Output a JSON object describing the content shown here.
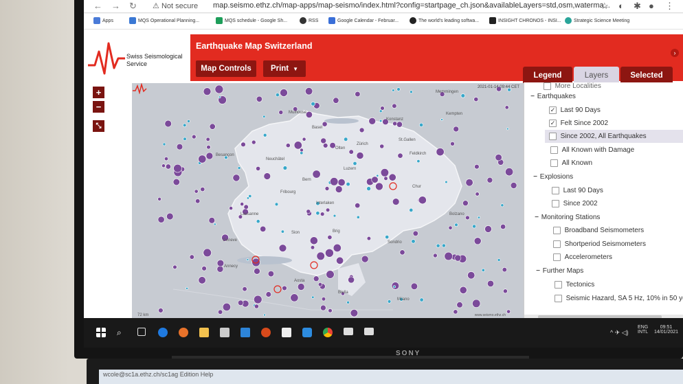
{
  "browser": {
    "not_secure": "Not secure",
    "url": "map.seismo.ethz.ch/map-apps/map-seismo/index.html?config=startpage_ch.json&availableLayers=std,osm,waterma...",
    "bookmarks": [
      {
        "label": "Apps",
        "color": "#4a7bd8"
      },
      {
        "label": "MQS Operational Planning...",
        "color": "#3b78d4"
      },
      {
        "label": "MQS schedule - Google Sh...",
        "color": "#1e9e5a"
      },
      {
        "label": "RSS",
        "color": "#333333"
      },
      {
        "label": "Google Calendar - Februar...",
        "color": "#3a6fd8"
      },
      {
        "label": "The world's leading softwa...",
        "color": "#222222"
      },
      {
        "label": "INSIGHT CHRONOS - INSI...",
        "color": "#222222"
      },
      {
        "label": "Strategic Science Meeting",
        "color": "#2aa59a"
      }
    ]
  },
  "app": {
    "logo_line1": "Swiss Seismological",
    "logo_line2": "Service",
    "title": "Earthquake Map Switzerland",
    "buttons": {
      "map_controls": "Map Controls",
      "print": "Print"
    },
    "tabs": {
      "legend": "Legend",
      "layers": "Layers",
      "selected": "Selected"
    },
    "zoom_in": "+",
    "zoom_out": "−",
    "accent": "#e22b20"
  },
  "map": {
    "timestamp": "2021-01-14 09:44 CET",
    "credit": "www.seismo.ethz.ch",
    "scale_label": "72 km",
    "places": [
      "Memmingen",
      "Kempten",
      "Mulhouse",
      "Basel",
      "Konstanz",
      "St.Gallen",
      "Zürich",
      "Olten",
      "Feldkirch",
      "Besançon",
      "Neuchâtel",
      "Luzern",
      "Bern",
      "Chur",
      "Fribourg",
      "Interlaken",
      "Lausanne",
      "Sion",
      "Brig",
      "Geneve",
      "Annecy",
      "Aosta",
      "Biella",
      "Bolzano",
      "Milano",
      "Sondrio"
    ]
  },
  "layers": {
    "partial_top": "More Localities",
    "groups": [
      {
        "label": "Earthquakes",
        "items": [
          {
            "label": "Last 90 Days",
            "checked": true
          },
          {
            "label": "Felt Since 2002",
            "checked": true
          },
          {
            "label": "Since 2002, All Earthquakes",
            "checked": false
          },
          {
            "label": "All Known with Damage",
            "checked": false
          },
          {
            "label": "All Known",
            "checked": false
          }
        ]
      },
      {
        "label": "Explosions",
        "items": [
          {
            "label": "Last 90 Days",
            "checked": false
          },
          {
            "label": "Since 2002",
            "checked": false
          }
        ]
      },
      {
        "label": "Monitoring Stations",
        "items": [
          {
            "label": "Broadband Seismometers",
            "checked": false
          },
          {
            "label": "Shortperiod Seismometers",
            "checked": false
          },
          {
            "label": "Accelerometers",
            "checked": false
          }
        ]
      },
      {
        "label": "Further Maps",
        "items": [
          {
            "label": "Tectonics",
            "checked": false
          },
          {
            "label": "Seismic Hazard, SA 5 Hz, 10% in 50 ye",
            "checked": false
          }
        ]
      }
    ]
  },
  "taskbar": {
    "lang1": "ENG",
    "lang2": "INTL",
    "time": "09:51",
    "date": "14/01/2021"
  },
  "monitor_brand": "SONY",
  "second_screen_text": "wcole@sc1a.ethz.ch/sc1ag   Edition  Help"
}
